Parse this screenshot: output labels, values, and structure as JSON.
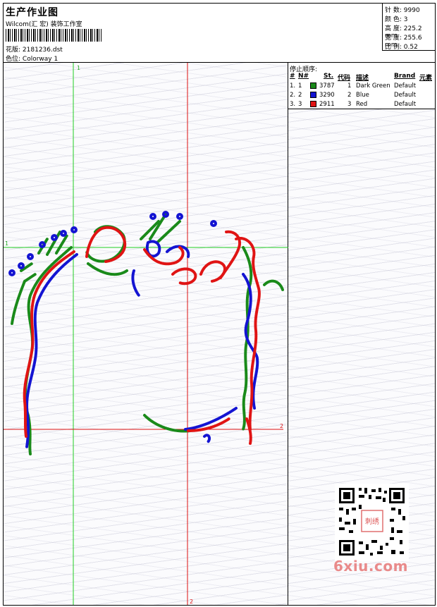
{
  "header": {
    "title": "生产作业图",
    "subtitle": "Wilcom(汇 宏) 装饰工作室",
    "design_label": "花版:",
    "design_value": "2181236.dst",
    "colorway_label": "色位:",
    "colorway_value": "Colorway 1"
  },
  "stats": [
    {
      "label": "针 数:",
      "value": "9990"
    },
    {
      "label": "颜 色:",
      "value": "3"
    },
    {
      "label": "高 度:",
      "value": "225.2 mm"
    },
    {
      "label": "宽 度:",
      "value": "255.6 mm"
    },
    {
      "label": "比 例:",
      "value": "0.52"
    }
  ],
  "stops": {
    "title": "停止顺序:",
    "headers": {
      "num": "#",
      "no": "N#",
      "st": "St.",
      "code": "代码",
      "desc": "描述",
      "brand": "Brand",
      "elem": "元素"
    },
    "rows": [
      {
        "num": "1.",
        "no": "1",
        "color": "#1a8a1a",
        "st": "3787",
        "code": "1",
        "desc": "Dark Green",
        "brand": "Default"
      },
      {
        "num": "2.",
        "no": "2",
        "color": "#1414d2",
        "st": "3290",
        "code": "2",
        "desc": "Blue",
        "brand": "Default"
      },
      {
        "num": "3.",
        "no": "3",
        "color": "#e01414",
        "st": "2911",
        "code": "3",
        "desc": "Red",
        "brand": "Default"
      }
    ]
  },
  "guides": {
    "vertical_labels": [
      "1",
      "2"
    ],
    "horizontal_labels": [
      "1",
      "2"
    ],
    "green": "#22cc22",
    "red": "#dd1111"
  },
  "watermark": "6xiu.com",
  "qr_badge": "刺绣"
}
